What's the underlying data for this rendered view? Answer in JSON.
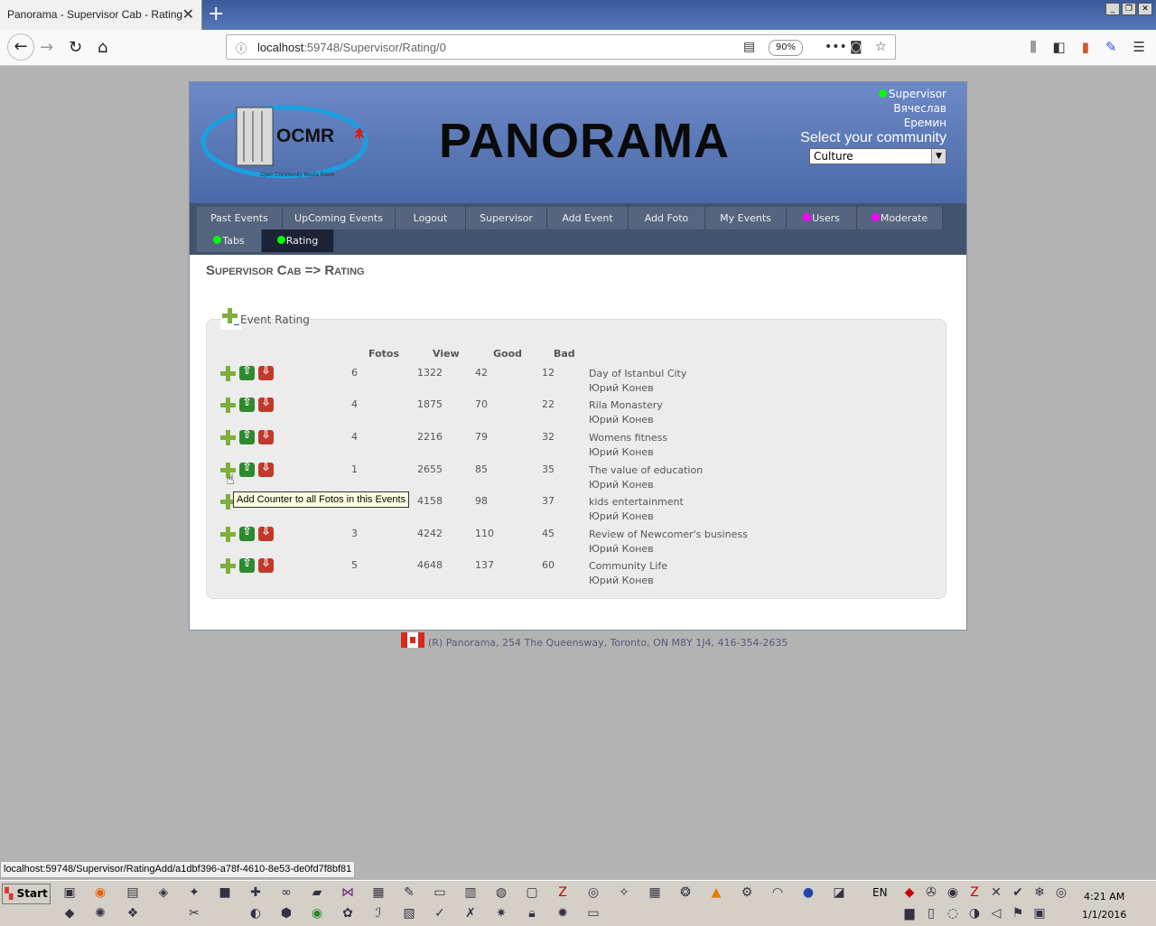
{
  "browser": {
    "tab_title": "Panorama - Supervisor Cab - Rating",
    "url_host": "localhost",
    "url_rest": ":59748/Supervisor/Rating/0",
    "zoom": "90%",
    "status_url": "localhost:59748/Supervisor/RatingAdd/a1dbf396-a78f-4610-8e53-de0fd7f8bf81"
  },
  "header": {
    "logo_text": "OCMR",
    "logo_sub": "Open Community Media Room",
    "brand": "PANORAMA",
    "role": "Supervisor",
    "first_name": "Вячеслав",
    "last_name": "Еремин",
    "community_label": "Select your community",
    "community_value": "Culture"
  },
  "menu": [
    {
      "label": "Past Events"
    },
    {
      "label": "UpComing Events"
    },
    {
      "label": "Logout"
    },
    {
      "label": "Supervisor"
    },
    {
      "label": "Add Event"
    },
    {
      "label": "Add Foto"
    },
    {
      "label": "My Events"
    },
    {
      "label": "Users"
    },
    {
      "label": "Moderate"
    },
    {
      "label": "Tabs"
    },
    {
      "label": "Rating"
    }
  ],
  "page_title": "Supervisor Cab => Rating",
  "rating": {
    "legend": "Event Rating",
    "columns": {
      "fotos": "Fotos",
      "view": "View",
      "good": "Good",
      "bad": "Bad"
    },
    "rows": [
      {
        "fotos": "6",
        "view": "1322",
        "good": "42",
        "bad": "12",
        "event": "Day of Istanbul City",
        "author": "Юрий Конев"
      },
      {
        "fotos": "4",
        "view": "1875",
        "good": "70",
        "bad": "22",
        "event": "Rila Monastery",
        "author": "Юрий Конев"
      },
      {
        "fotos": "4",
        "view": "2216",
        "good": "79",
        "bad": "32",
        "event": "Womens fitness",
        "author": "Юрий Конев"
      },
      {
        "fotos": "1",
        "view": "2655",
        "good": "85",
        "bad": "35",
        "event": "The value of education",
        "author": "Юрий Конев"
      },
      {
        "fotos": "",
        "view": "4158",
        "good": "98",
        "bad": "37",
        "event": "kids entertainment",
        "author": "Юрий Конев"
      },
      {
        "fotos": "3",
        "view": "4242",
        "good": "110",
        "bad": "45",
        "event": "Review of Newcomer's business",
        "author": "Юрий Конев"
      },
      {
        "fotos": "5",
        "view": "4648",
        "good": "137",
        "bad": "60",
        "event": "Community Life",
        "author": "Юрий Конев"
      }
    ],
    "tooltip": "Add Counter to all Fotos in this Events"
  },
  "footer": "(R) Panorama, 254 The Queensway, Toronto, ON M8Y 1J4, 416-354-2635",
  "taskbar": {
    "start": "Start",
    "lang": "EN",
    "time": "4:21 AM",
    "date": "1/1/2016"
  }
}
